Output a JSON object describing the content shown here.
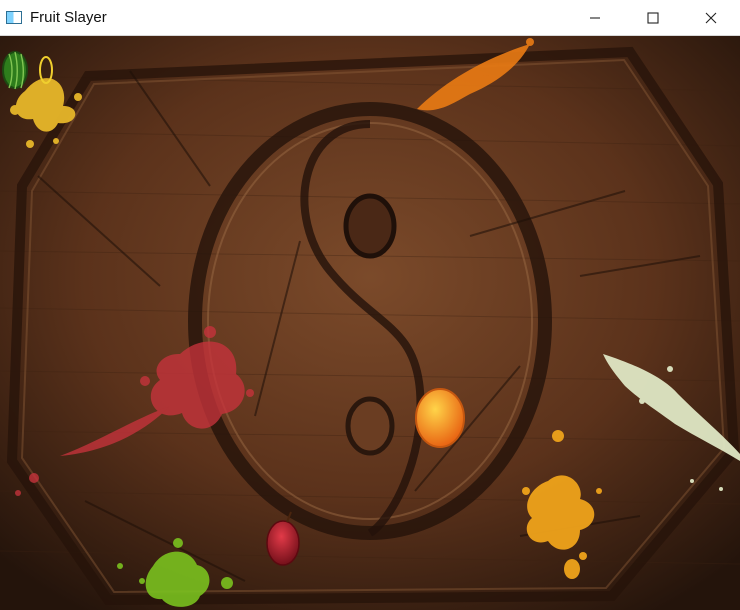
{
  "window": {
    "title": "Fruit Slayer",
    "icon": "app-window-icon",
    "controls": [
      "minimize-icon",
      "maximize-icon",
      "close-icon"
    ]
  },
  "board": {
    "description_colors": {
      "wood_dark": "#2a170d",
      "wood_mid": "#5a321c",
      "wood_light": "#7a4a2b",
      "groove": "#1e100a"
    },
    "emblem": "yin-yang",
    "splatters": [
      {
        "name": "yellow-splatter-top-left",
        "color": "#e7b72a"
      },
      {
        "name": "orange-splatter-top",
        "color": "#ea7b14"
      },
      {
        "name": "red-splatter-left",
        "color": "#c7333c"
      },
      {
        "name": "yellow-splatter-right",
        "color": "#efa31b"
      },
      {
        "name": "green-splatter-bottom",
        "color": "#7cc51f"
      }
    ],
    "fruits": [
      {
        "name": "watermelon-icon",
        "color": "#2e7d1c"
      },
      {
        "name": "orange-fruit",
        "color": "#f29a13"
      },
      {
        "name": "red-fruit",
        "color": "#b61e2b"
      }
    ],
    "blade_trail_color": "#dfe7c4"
  }
}
